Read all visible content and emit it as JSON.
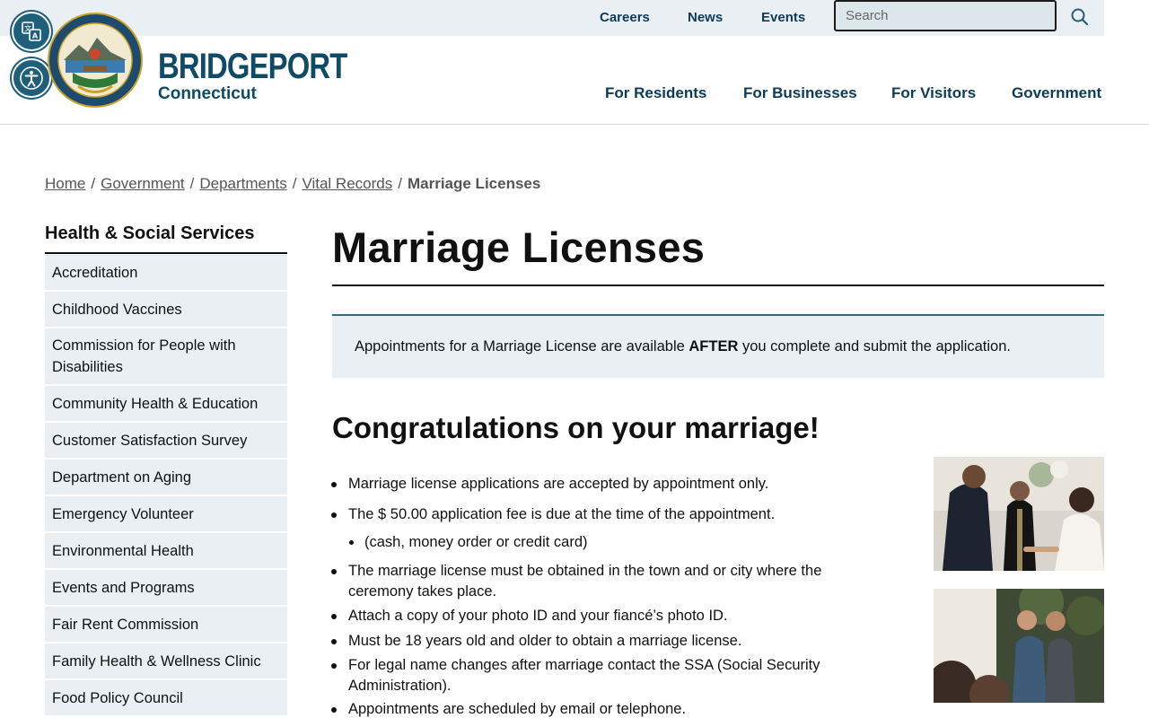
{
  "utility_nav": {
    "careers": "Careers",
    "news": "News",
    "events": "Events",
    "search_placeholder": "Search"
  },
  "brand": {
    "name": "BRIDGEPORT",
    "subtitle": "Connecticut"
  },
  "main_nav": {
    "residents": "For Residents",
    "businesses": "For Businesses",
    "visitors": "For Visitors",
    "government": "Government"
  },
  "breadcrumb": {
    "home": "Home",
    "government": "Government",
    "departments": "Departments",
    "vital_records": "Vital Records",
    "current": "Marriage Licenses",
    "separator": "/"
  },
  "sidebar": {
    "title": "Health & Social Services",
    "items": [
      "Accreditation",
      "Childhood Vaccines",
      "Commission for People with Disabilities",
      "Community Health & Education",
      "Customer Satisfaction Survey",
      "Department on Aging",
      "Emergency Volunteer",
      "Environmental Health",
      "Events and Programs",
      "Fair Rent Commission",
      "Family Health & Wellness Clinic",
      "Food Policy Council"
    ]
  },
  "main": {
    "title": "Marriage Licenses",
    "notice_before": "Appointments for a Marriage License are available ",
    "notice_bold": "AFTER",
    "notice_after": " you complete and submit the application.",
    "section_heading": "Congratulations on your marriage!",
    "bullets": [
      "Marriage license applications are accepted by appointment only.",
      "The $ 50.00 application fee is due at the time of the appointment.",
      "(cash, money order or credit card)",
      "The marriage license must be obtained in the town and or city where the ceremony takes place.",
      "Attach a copy of your photo ID and your fiancé’s photo ID.",
      "Must be 18 years old and older to obtain a marriage license.",
      "For legal name changes after marriage contact the SSA (Social Security Administration).",
      "Appointments are scheduled by email or telephone."
    ]
  },
  "colors": {
    "brand": "#0f4a66",
    "nav": "#0d3b57",
    "panel": "#e9eff2",
    "accent_border": "#2e6e8c"
  },
  "icons": {
    "translate": "translate-icon",
    "accessibility": "accessibility-icon",
    "search": "search-icon",
    "seal": "city-seal-logo"
  }
}
